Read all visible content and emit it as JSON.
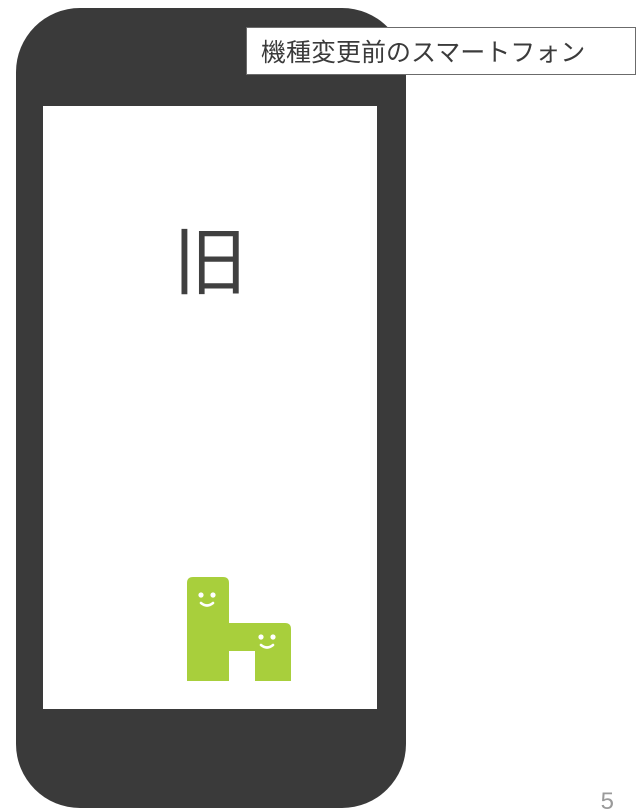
{
  "caption": {
    "text": "機種変更前のスマートフォン"
  },
  "phone": {
    "screen_label": "旧",
    "mascot_icon": "green-h-mascot-icon",
    "colors": {
      "body": "#3a3a3a",
      "screen": "#ffffff",
      "mascot": "#a8cf3c"
    }
  },
  "page": {
    "number": "5"
  }
}
